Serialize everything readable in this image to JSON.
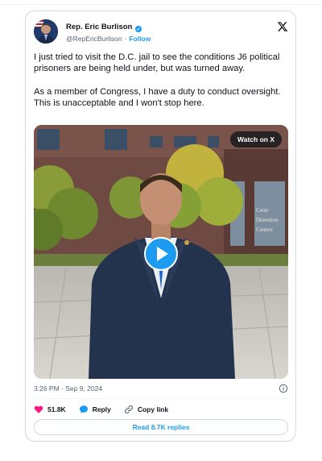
{
  "author": {
    "name": "Rep. Eric Burlison",
    "handle": "@RepEricBurlison",
    "separator": "·",
    "follow_label": "Follow"
  },
  "post": {
    "paragraph_1": "I just tried to visit the D.C. jail to see the conditions J6 political prisoners are being held under, but was turned away.",
    "paragraph_2": "As a member of Congress, I have a duty to conduct oversight. This is unacceptable and I won't stop here."
  },
  "media": {
    "watch_label": "Watch on X",
    "building_sign_line_1": "Centr",
    "building_sign_line_2": "Detention",
    "building_sign_line_3": "Centerr"
  },
  "timestamp": "3:26 PM · Sep 9, 2024",
  "actions": {
    "likes": "51.8K",
    "reply_label": "Reply",
    "copy_link_label": "Copy link"
  },
  "read_replies_label": "Read 8.7K replies",
  "colors": {
    "accent": "#1d9bf0",
    "like": "#f91880",
    "text": "#0f1419",
    "muted": "#536471",
    "border": "#cfd9de"
  },
  "icons": {
    "verified": "verified-badge-icon",
    "platform": "x-logo-icon",
    "play": "play-icon",
    "info": "info-icon",
    "like": "heart-icon",
    "reply": "speech-bubble-icon",
    "copy": "link-icon"
  }
}
